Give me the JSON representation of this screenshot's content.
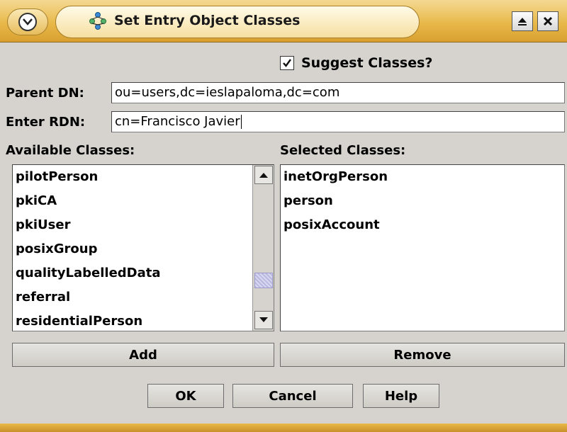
{
  "window": {
    "title": "Set Entry Object Classes",
    "menu_icon": "circle-chevron-down-icon",
    "app_icon": "ldap-tree-icon",
    "maximize_icon": "maximize-icon",
    "close_icon": "close-icon"
  },
  "suggest": {
    "label": "Suggest Classes?",
    "checked": true
  },
  "parent_dn": {
    "label": "Parent DN:",
    "value": "ou=users,dc=ieslapaloma,dc=com"
  },
  "rdn": {
    "label": "Enter RDN:",
    "value": "cn=Francisco Javier"
  },
  "available": {
    "label": "Available Classes:",
    "items": [
      "pilotPerson",
      "pkiCA",
      "pkiUser",
      "posixGroup",
      "qualityLabelledData",
      "referral",
      "residentialPerson"
    ]
  },
  "selected": {
    "label": "Selected Classes:",
    "items": [
      "inetOrgPerson",
      "person",
      "posixAccount"
    ]
  },
  "buttons": {
    "add": "Add",
    "remove": "Remove",
    "ok": "OK",
    "cancel": "Cancel",
    "help": "Help"
  },
  "colors": {
    "titlebar": "#e8b94a",
    "dialog_bg": "#d6d3ce",
    "scroll_thumb": "#b8b8e0"
  }
}
